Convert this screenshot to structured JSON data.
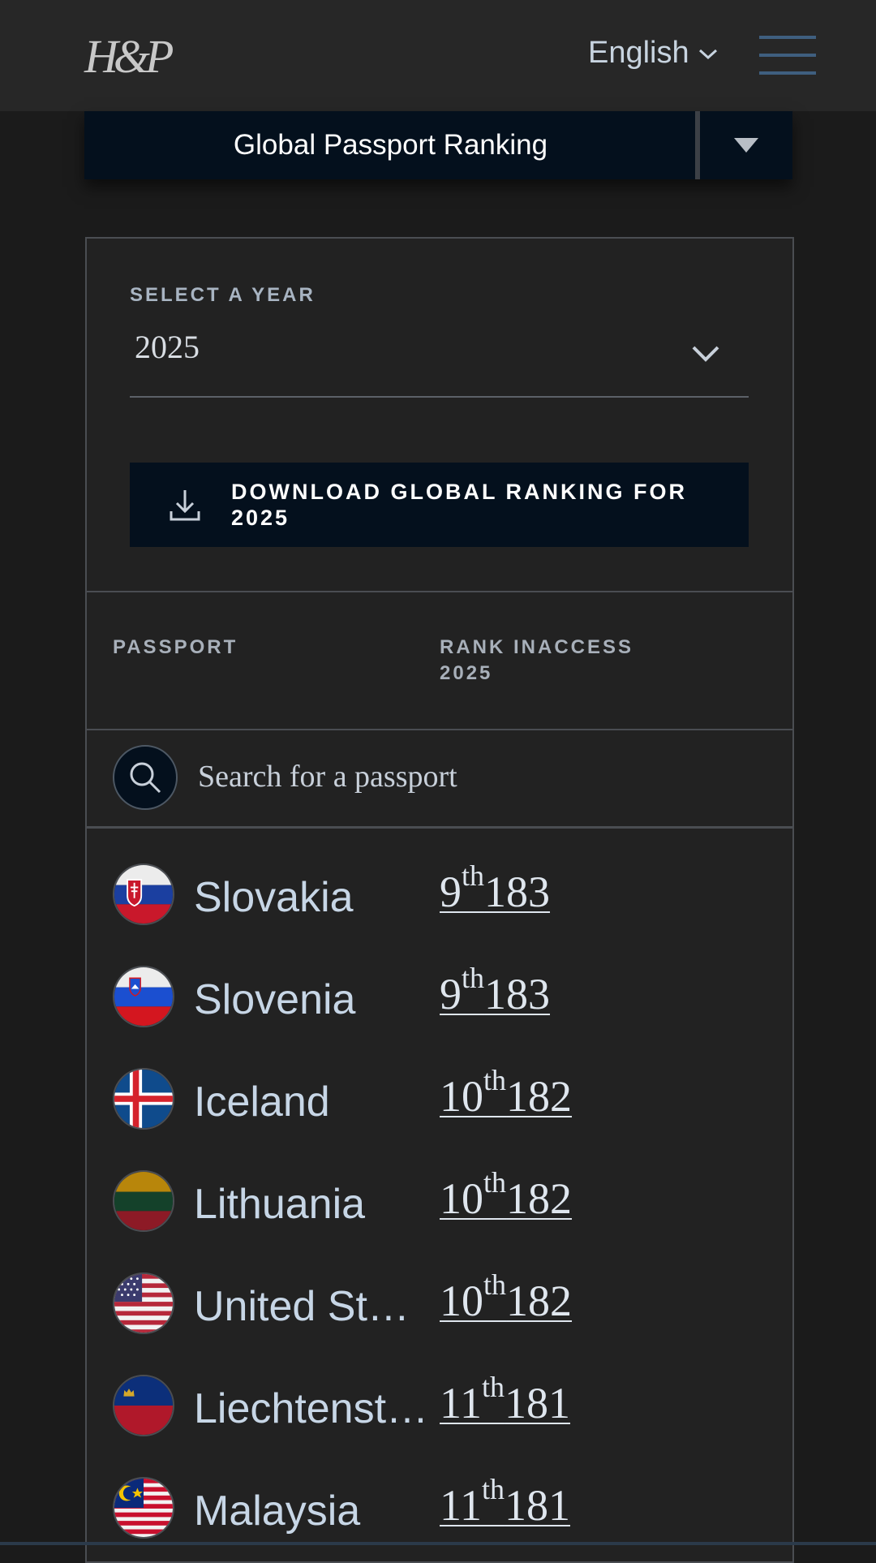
{
  "header": {
    "logo_text": "H&P",
    "language": "English"
  },
  "ranking_menu": {
    "title": "Global Passport Ranking"
  },
  "year_filter": {
    "label": "SELECT A YEAR",
    "selected": "2025"
  },
  "download": {
    "label": "DOWNLOAD GLOBAL RANKING FOR 2025"
  },
  "table": {
    "col_passport": "PASSPORT",
    "col_rank": "RANK",
    "col_access_line1": "INACCESS",
    "col_access_line2": "2025"
  },
  "search": {
    "placeholder": "Search for a passport"
  },
  "passports": [
    {
      "country": "Slovakia",
      "rank": "9",
      "suffix": "th",
      "access": "183",
      "flag": "slovakia-flag"
    },
    {
      "country": "Slovenia",
      "rank": "9",
      "suffix": "th",
      "access": "183",
      "flag": "slovenia-flag"
    },
    {
      "country": "Iceland",
      "rank": "10",
      "suffix": "th",
      "access": "182",
      "flag": "iceland-flag"
    },
    {
      "country": "Lithuania",
      "rank": "10",
      "suffix": "th",
      "access": "182",
      "flag": "lithuania-flag"
    },
    {
      "country": "United Stat…",
      "rank": "10",
      "suffix": "th",
      "access": "182",
      "flag": "usa-flag"
    },
    {
      "country": "Liechtenst…",
      "rank": "11",
      "suffix": "th",
      "access": "181",
      "flag": "liechtenstein-flag"
    },
    {
      "country": "Malaysia",
      "rank": "11",
      "suffix": "th",
      "access": "181",
      "flag": "malaysia-flag"
    }
  ],
  "colors": {
    "background": "#1b1b1b",
    "header": "#272727",
    "navy": "#04101d",
    "text_light": "#c7d6e6"
  }
}
